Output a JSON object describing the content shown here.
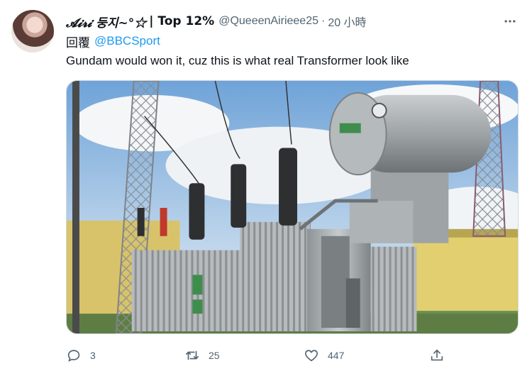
{
  "tweet": {
    "display_name": "𝓐𝓲𝓻𝓲 둥지~°☆",
    "display_suffix": "| Top 12%",
    "handle": "@QueeenAirieee25",
    "separator": "·",
    "time": "20 小時",
    "reply_label": "回覆",
    "reply_handle": "@BBCSport",
    "text": "Gundam would won it, cuz this is what real Transformer look like",
    "media_description": "photo-of-electrical-power-transformer",
    "icons": {
      "more": "more-horizontal-icon",
      "reply": "reply-icon",
      "retweet": "retweet-icon",
      "like": "heart-icon",
      "share": "share-icon"
    }
  },
  "actions": {
    "reply_count": "3",
    "retweet_count": "25",
    "like_count": "447"
  },
  "colors": {
    "link_blue": "#1d9bf0",
    "muted_gray": "#536471",
    "text": "#0f1419",
    "border": "#cfd9de"
  }
}
